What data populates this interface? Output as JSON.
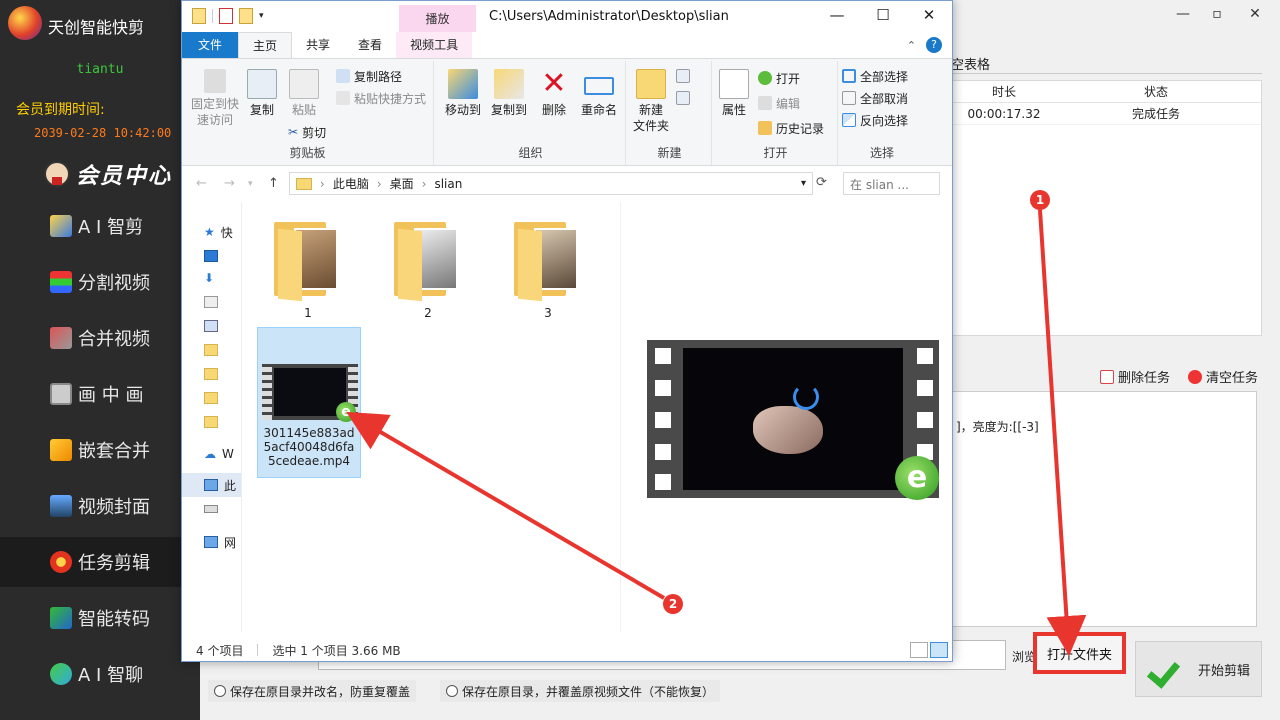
{
  "app": {
    "title": "天创智能快剪",
    "user": "tiantu",
    "expire_label": "会员到期时间:",
    "expire_date": "2039-02-28 10:42:00",
    "member_center": "会员中心"
  },
  "sidebar": {
    "items": [
      {
        "label": "A I 智剪",
        "icon": "ai-edit-icon",
        "active": false
      },
      {
        "label": "分割视频",
        "icon": "split-video-icon",
        "active": false
      },
      {
        "label": "合并视频",
        "icon": "merge-video-icon",
        "active": false
      },
      {
        "label": "画 中 画",
        "icon": "picture-in-picture-icon",
        "active": false
      },
      {
        "label": "嵌套合并",
        "icon": "nested-merge-icon",
        "active": false
      },
      {
        "label": "视频封面",
        "icon": "video-cover-icon",
        "active": false
      },
      {
        "label": "任务剪辑",
        "icon": "task-edit-icon",
        "active": true
      },
      {
        "label": "智能转码",
        "icon": "transcode-icon",
        "active": false
      },
      {
        "label": "A I 智聊",
        "icon": "ai-chat-icon",
        "active": false
      }
    ]
  },
  "main": {
    "clear_table": "空表格",
    "table_headers": [
      "时长",
      "状态"
    ],
    "table_rows": [
      [
        "00:00:17.32",
        "完成任务"
      ]
    ],
    "delete_task": "删除任务",
    "clear_task": "清空任务",
    "log_text": "]，亮度为:[[-3]",
    "browse": "浏览",
    "open_folder": "打开文件夹",
    "start_edit": "开始剪辑",
    "radio_options": [
      "保存在原目录并改名，防重复覆盖",
      "保存在原目录，并覆盖原视频文件（不能恢复）"
    ]
  },
  "explorer": {
    "path": "C:\\Users\\Administrator\\Desktop\\slian",
    "context_tab": "播放",
    "tabs": [
      "文件",
      "主页",
      "共享",
      "查看",
      "视频工具"
    ],
    "active_tab": "主页",
    "ribbon": {
      "clipboard": {
        "pin": "固定到快\n速访问",
        "copy": "复制",
        "paste": "粘贴",
        "copy_path": "复制路径",
        "paste_shortcut": "粘贴快捷方式",
        "cut": "剪切",
        "label": "剪贴板"
      },
      "organize": {
        "move_to": "移动到",
        "copy_to": "复制到",
        "delete": "删除",
        "rename": "重命名",
        "label": "组织"
      },
      "new": {
        "new_folder": "新建\n文件夹",
        "label": "新建"
      },
      "open": {
        "properties": "属性",
        "open": "打开",
        "edit": "编辑",
        "history": "历史记录",
        "label": "打开"
      },
      "select": {
        "select_all": "全部选择",
        "select_none": "全部取消",
        "invert": "反向选择",
        "label": "选择"
      }
    },
    "breadcrumb": [
      "此电脑",
      "桌面",
      "slian"
    ],
    "search_placeholder": "在 slian ...",
    "nav_pane": [
      "快",
      "W",
      "此",
      "网"
    ],
    "files": [
      {
        "name": "1",
        "type": "folder"
      },
      {
        "name": "2",
        "type": "folder"
      },
      {
        "name": "3",
        "type": "folder"
      },
      {
        "name": "301145e883ad5acf40048d6fa5cedeae.mp4",
        "type": "video",
        "selected": true
      }
    ],
    "status_items": "4 个项目",
    "status_selected": "选中 1 个项目  3.66 MB"
  },
  "annotations": {
    "badge1": "1",
    "badge2": "2",
    "arrow_color": "#e8362f"
  }
}
